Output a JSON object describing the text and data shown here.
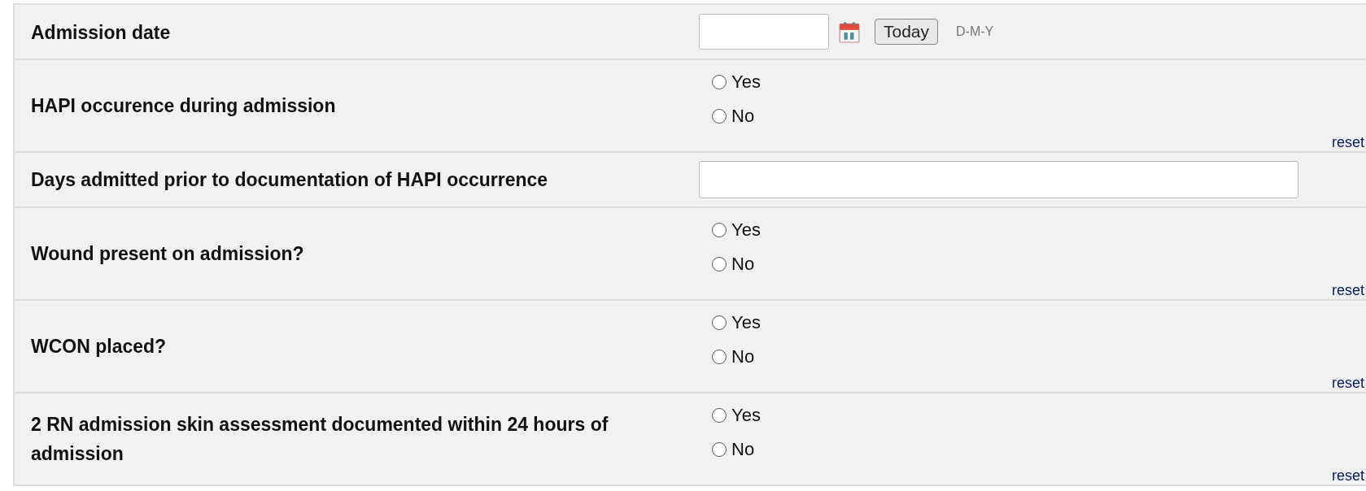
{
  "fields": [
    {
      "kind": "date",
      "label": "Admission date",
      "button": "Today",
      "format": "D-M-Y"
    },
    {
      "kind": "radio",
      "label": "HAPI occurence during admission",
      "options": [
        {
          "label": "Yes",
          "selected": false
        },
        {
          "label": "No",
          "selected": false
        }
      ],
      "reset": "reset"
    },
    {
      "kind": "text",
      "label": "Days admitted prior to documentation of HAPI occurrence"
    },
    {
      "kind": "radio",
      "label": "Wound present on admission?",
      "options": [
        {
          "label": "Yes",
          "selected": false
        },
        {
          "label": "No",
          "selected": false
        }
      ],
      "reset": "reset"
    },
    {
      "kind": "radio",
      "label": "WCON placed?",
      "options": [
        {
          "label": "Yes",
          "selected": false
        },
        {
          "label": "No",
          "selected": false
        }
      ],
      "reset": "reset"
    },
    {
      "kind": "radio",
      "label": "2 RN admission skin assessment documented within 24 hours of admission",
      "options": [
        {
          "label": "Yes",
          "selected": false
        },
        {
          "label": "No",
          "selected": false
        }
      ],
      "reset": "reset"
    }
  ]
}
